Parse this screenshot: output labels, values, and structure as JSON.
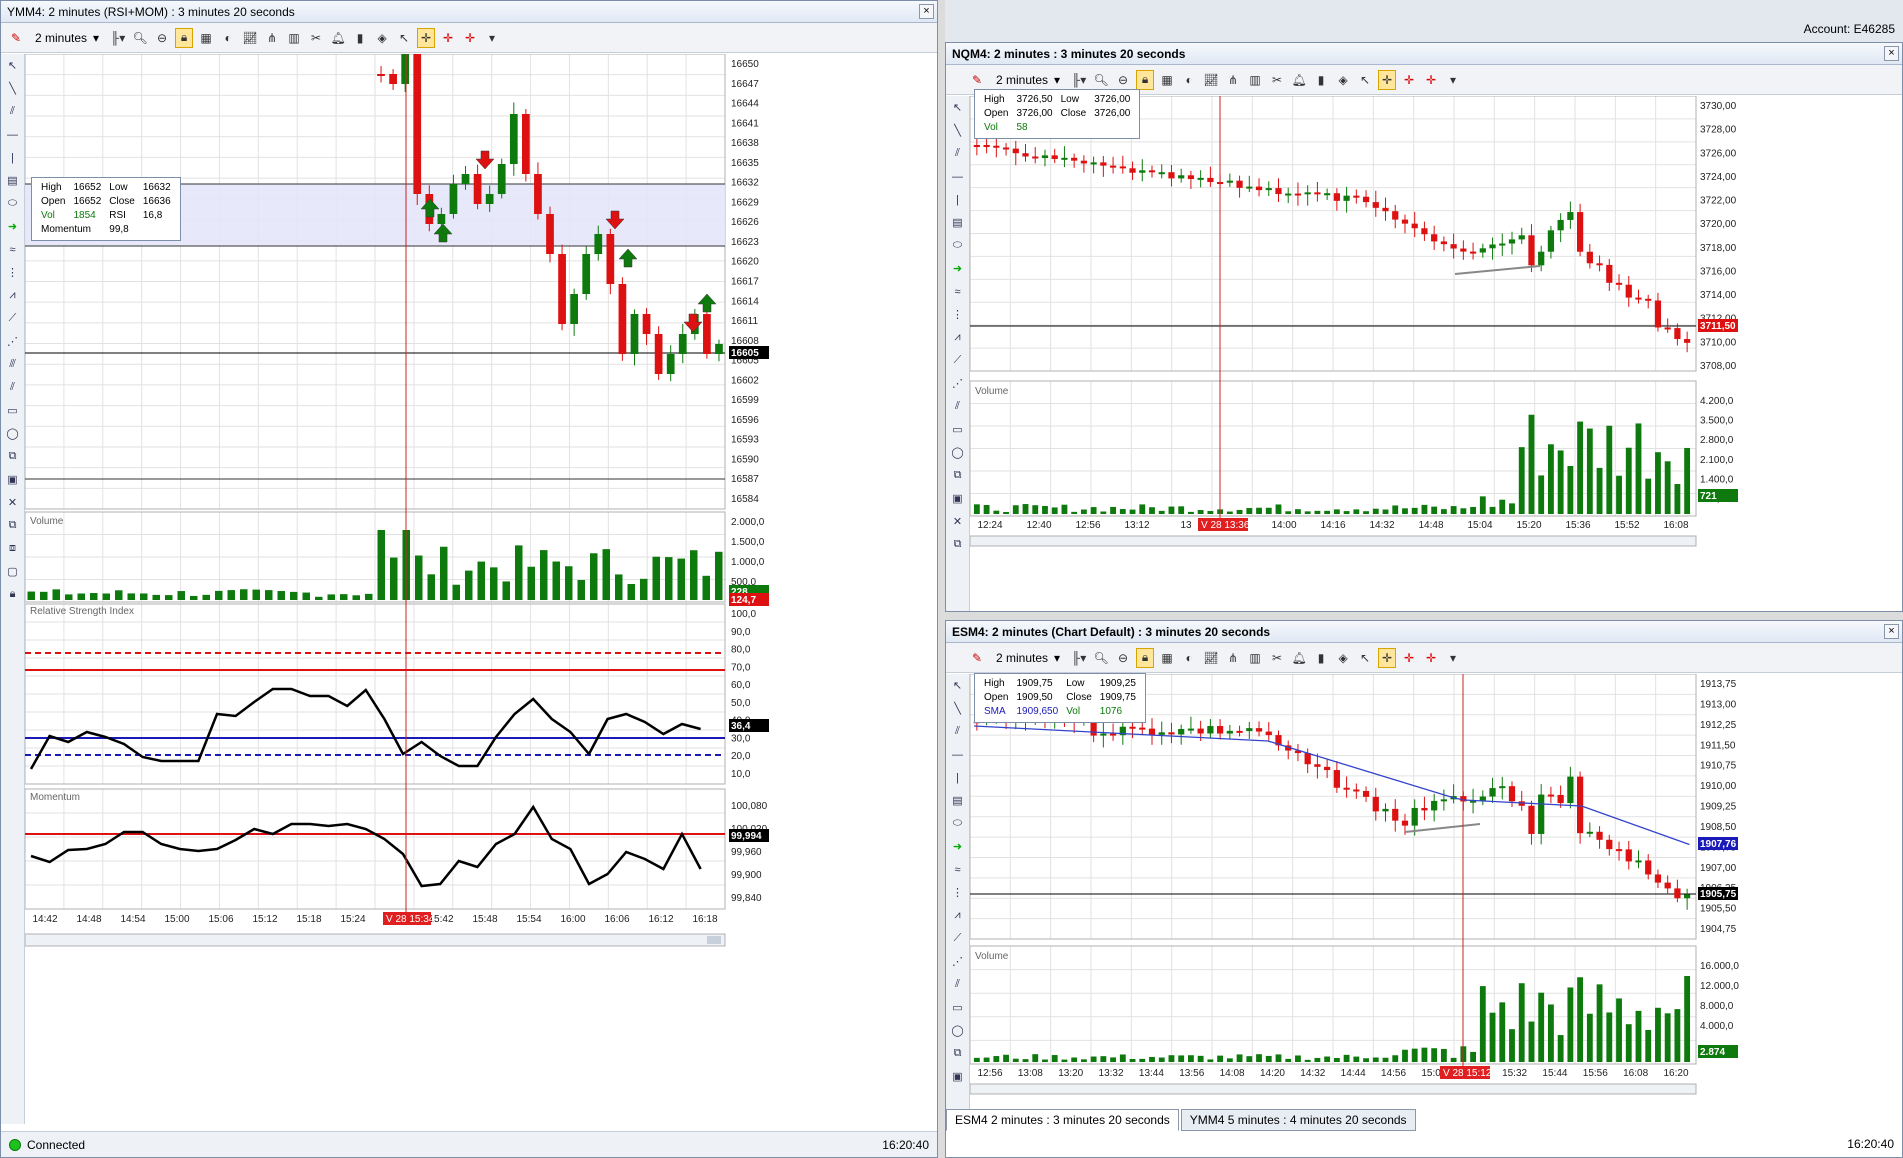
{
  "account_label": "Account: E46285",
  "left_chart": {
    "title": "YMM4: 2 minutes (RSI+MOM) : 3 minutes 20 seconds",
    "interval": "2 minutes",
    "instrument": "YMM4",
    "info": {
      "high_label": "High",
      "high": "16652",
      "low_label": "Low",
      "low": "16632",
      "open_label": "Open",
      "open": "16652",
      "close_label": "Close",
      "close": "16636",
      "vol_label": "Vol",
      "vol": "1854",
      "rsi_label": "RSI",
      "rsi": "16,8",
      "mom_label": "Momentum",
      "mom": "99,8"
    },
    "price_axis": [
      "16650",
      "16647",
      "16644",
      "16641",
      "16638",
      "16635",
      "16632",
      "16629",
      "16626",
      "16623",
      "16620",
      "16617",
      "16614",
      "16611",
      "16608",
      "16605",
      "16602",
      "16599",
      "16596",
      "16593",
      "16590",
      "16587",
      "16584"
    ],
    "last_price": "16605",
    "volume_label": "Volume",
    "volume_axis": [
      "2.000,0",
      "1.500,0",
      "1.000,0",
      "500,0"
    ],
    "volume_last": "228",
    "volume_ind": "124,7",
    "rsi_label": "Relative Strength Index",
    "rsi_axis": [
      "100,0",
      "90,0",
      "80,0",
      "70,0",
      "60,0",
      "50,0",
      "40,0",
      "30,0",
      "20,0",
      "10,0"
    ],
    "rsi_last": "36,4",
    "mom_panel_label": "Momentum",
    "mom_axis": [
      "100,080",
      "100,020",
      "99,960",
      "99,900",
      "99,840"
    ],
    "mom_last": "99,994",
    "time_axis": [
      "14:42",
      "14:48",
      "14:54",
      "15:00",
      "15:06",
      "15:12",
      "15:18",
      "15:24",
      "15:3",
      "15:42",
      "15:48",
      "15:54",
      "16:00",
      "16:06",
      "16:12",
      "16:18"
    ],
    "cursor_time": "V 28 15:34",
    "status": "Connected",
    "clock": "16:20:40"
  },
  "nq_chart": {
    "title": "NQM4: 2 minutes : 3 minutes 20 seconds",
    "interval": "2 minutes",
    "info": {
      "high_label": "High",
      "high": "3726,50",
      "low_label": "Low",
      "low": "3726,00",
      "open_label": "Open",
      "open": "3726,00",
      "close_label": "Close",
      "close": "3726,00",
      "vol_label": "Vol",
      "vol": "58"
    },
    "price_axis": [
      "3730,00",
      "3728,00",
      "3726,00",
      "3724,00",
      "3722,00",
      "3720,00",
      "3718,00",
      "3716,00",
      "3714,00",
      "3712,00",
      "3710,00",
      "3708,00"
    ],
    "last_price": "3711,50",
    "volume_label": "Volume",
    "volume_axis": [
      "4.200,0",
      "3.500,0",
      "2.800,0",
      "2.100,0",
      "1.400,0",
      "700,0"
    ],
    "volume_last": "721",
    "time_axis": [
      "12:24",
      "12:40",
      "12:56",
      "13:12",
      "13",
      "44",
      "14:00",
      "14:16",
      "14:32",
      "14:48",
      "15:04",
      "15:20",
      "15:36",
      "15:52",
      "16:08"
    ],
    "cursor_time": "V 28 13:36"
  },
  "es_chart": {
    "title": "ESM4: 2 minutes (Chart Default) : 3 minutes 20 seconds",
    "interval": "2 minutes",
    "info": {
      "high_label": "High",
      "high": "1909,75",
      "low_label": "Low",
      "low": "1909,25",
      "open_label": "Open",
      "open": "1909,50",
      "close_label": "Close",
      "close": "1909,75",
      "sma_label": "SMA",
      "sma": "1909,650",
      "vol_label": "Vol",
      "vol": "1076"
    },
    "price_axis": [
      "1913,75",
      "1913,00",
      "1912,25",
      "1911,50",
      "1910,75",
      "1910,00",
      "1909,25",
      "1908,50",
      "1907,75",
      "1907,00",
      "1906,25",
      "1905,50",
      "1904,75"
    ],
    "sma_last": "1907,76",
    "last_price": "1905,75",
    "volume_label": "Volume",
    "volume_axis": [
      "16.000,0",
      "12.000,0",
      "8.000,0",
      "4.000,0"
    ],
    "volume_last": "2.874",
    "time_axis": [
      "12:56",
      "13:08",
      "13:20",
      "13:32",
      "13:44",
      "13:56",
      "14:08",
      "14:20",
      "14:32",
      "14:44",
      "14:56",
      "15:08",
      "15:20",
      "15:32",
      "15:44",
      "15:56",
      "16:08",
      "16:20"
    ],
    "cursor_time": "V 28 15:12",
    "tabs": [
      "ESM4 2 minutes : 3 minutes 20 seconds",
      "YMM4 5 minutes : 4 minutes 20 seconds"
    ],
    "clock": "16:20:40"
  },
  "colors": {
    "up": "#0e7a0e",
    "down": "#dd1111",
    "band": "#e4e6fa",
    "rsi_red": "#dd1111",
    "rsi_blue": "#1a1ab8",
    "sma": "#3344cc"
  }
}
